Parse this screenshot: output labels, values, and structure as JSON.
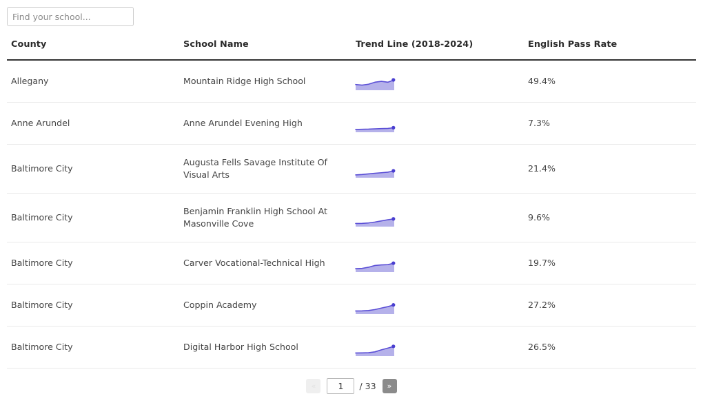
{
  "search": {
    "placeholder": "Find your school...",
    "value": "",
    "name": "search-input"
  },
  "table": {
    "columns": [
      {
        "key": "county",
        "label": "County"
      },
      {
        "key": "school",
        "label": "School Name"
      },
      {
        "key": "trend",
        "label": "Trend Line (2018-2024)"
      },
      {
        "key": "rate",
        "label": "English Pass Rate"
      }
    ],
    "rows": [
      {
        "county": "Allegany",
        "school": "Mountain Ridge High School",
        "rate": "49.4%",
        "trend": [
          0.3,
          0.26,
          0.32,
          0.46,
          0.52,
          0.46,
          0.62
        ]
      },
      {
        "county": "Anne Arundel",
        "school": "Anne Arundel Evening High",
        "rate": "7.3%",
        "trend": [
          0.1,
          0.11,
          0.12,
          0.14,
          0.16,
          0.17,
          0.22
        ]
      },
      {
        "county": "Baltimore City",
        "school": "Augusta Fells Savage Institute Of Visual Arts",
        "rate": "21.4%",
        "trend": [
          0.1,
          0.13,
          0.17,
          0.21,
          0.25,
          0.29,
          0.38
        ]
      },
      {
        "county": "Baltimore City",
        "school": "Benjamin Franklin High School At Masonville Cove",
        "rate": "9.6%",
        "trend": [
          0.12,
          0.13,
          0.16,
          0.22,
          0.3,
          0.38,
          0.44
        ]
      },
      {
        "county": "Baltimore City",
        "school": "Carver Vocational-Technical High",
        "rate": "19.7%",
        "trend": [
          0.14,
          0.16,
          0.24,
          0.36,
          0.4,
          0.42,
          0.52
        ]
      },
      {
        "county": "Baltimore City",
        "school": "Coppin Academy",
        "rate": "27.2%",
        "trend": [
          0.12,
          0.13,
          0.15,
          0.22,
          0.32,
          0.42,
          0.54
        ]
      },
      {
        "county": "Baltimore City",
        "school": "Digital Harbor High School",
        "rate": "26.5%",
        "trend": [
          0.12,
          0.13,
          0.14,
          0.2,
          0.34,
          0.46,
          0.58
        ]
      }
    ]
  },
  "chart_data": {
    "type": "line",
    "title": "Trend Line (2018-2024)",
    "xlabel": "",
    "ylabel": "English Pass Rate",
    "x": [
      2018,
      2019,
      2020,
      2021,
      2022,
      2023,
      2024
    ],
    "grid": false,
    "legend": "none",
    "series": [
      {
        "name": "Mountain Ridge High School",
        "values": [
          0.3,
          0.26,
          0.32,
          0.46,
          0.52,
          0.46,
          0.62
        ],
        "end_value": "49.4%"
      },
      {
        "name": "Anne Arundel Evening High",
        "values": [
          0.1,
          0.11,
          0.12,
          0.14,
          0.16,
          0.17,
          0.22
        ],
        "end_value": "7.3%"
      },
      {
        "name": "Augusta Fells Savage Institute Of Visual Arts",
        "values": [
          0.1,
          0.13,
          0.17,
          0.21,
          0.25,
          0.29,
          0.38
        ],
        "end_value": "21.4%"
      },
      {
        "name": "Benjamin Franklin High School At Masonville Cove",
        "values": [
          0.12,
          0.13,
          0.16,
          0.22,
          0.3,
          0.38,
          0.44
        ],
        "end_value": "9.6%"
      },
      {
        "name": "Carver Vocational-Technical High",
        "values": [
          0.14,
          0.16,
          0.24,
          0.36,
          0.4,
          0.42,
          0.52
        ],
        "end_value": "19.7%"
      },
      {
        "name": "Coppin Academy",
        "values": [
          0.12,
          0.13,
          0.15,
          0.22,
          0.32,
          0.42,
          0.54
        ],
        "end_value": "27.2%"
      },
      {
        "name": "Digital Harbor High School",
        "values": [
          0.12,
          0.13,
          0.14,
          0.2,
          0.34,
          0.46,
          0.58
        ],
        "end_value": "26.5%"
      }
    ]
  },
  "colors": {
    "spark_line": "#5b4fd6",
    "spark_fill": "#b5b1ea",
    "spark_dot": "#4a3fd0",
    "header_rule": "#333333",
    "row_rule": "#e9e9e9",
    "next_button": "#8b8b8b",
    "prev_button": "#efefef"
  },
  "pagination": {
    "prev_label": "«",
    "next_label": "»",
    "current_page": "1",
    "total_label": "/ 33",
    "total_pages": 33
  }
}
